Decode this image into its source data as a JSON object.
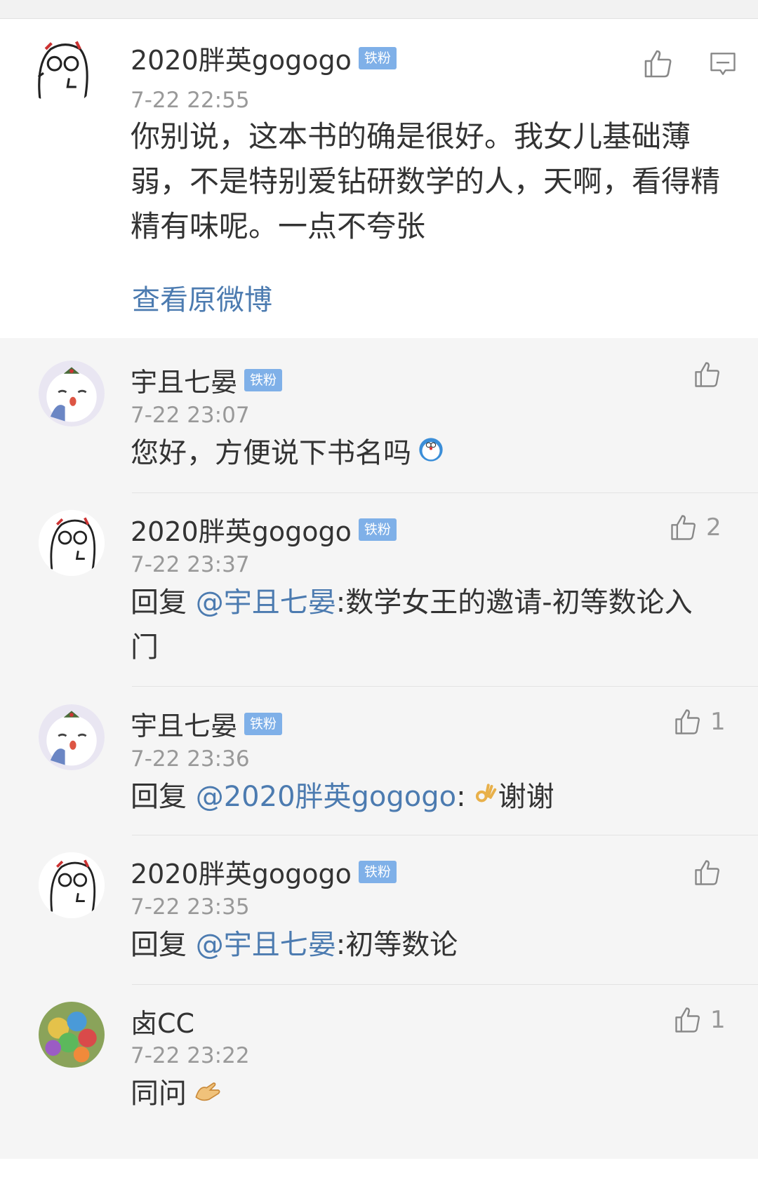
{
  "main_post": {
    "username": "2020胖英gogogo",
    "badge": "铁粉",
    "timestamp": "7-22 22:55",
    "content": "你别说，这本书的确是很好。我女儿基础薄弱，不是特别爱钻研数学的人，天啊，看得精精有味呢。一点不夸张",
    "view_original": "查看原微博"
  },
  "replies": [
    {
      "username": "宇且七晏",
      "badge": "铁粉",
      "timestamp": "7-22 23:07",
      "text": "您好，方便说下书名吗",
      "like_count": ""
    },
    {
      "username": "2020胖英gogogo",
      "badge": "铁粉",
      "timestamp": "7-22 23:37",
      "prefix": "回复 ",
      "mention": "@宇且七晏",
      "text": ":数学女王的邀请-初等数论入门",
      "like_count": "2"
    },
    {
      "username": "宇且七晏",
      "badge": "铁粉",
      "timestamp": "7-22 23:36",
      "prefix": "回复 ",
      "mention": "@2020胖英gogogo",
      "text": "谢谢",
      "like_count": "1"
    },
    {
      "username": "2020胖英gogogo",
      "badge": "铁粉",
      "timestamp": "7-22 23:35",
      "prefix": "回复 ",
      "mention": "@宇且七晏",
      "text": ":初等数论",
      "like_count": ""
    },
    {
      "username": "卤CC",
      "timestamp": "7-22 23:22",
      "text": "同问",
      "like_count": "1"
    }
  ],
  "colors": {
    "link": "#4c7bb0",
    "badge": "#7fb0e8",
    "muted": "#999999"
  }
}
